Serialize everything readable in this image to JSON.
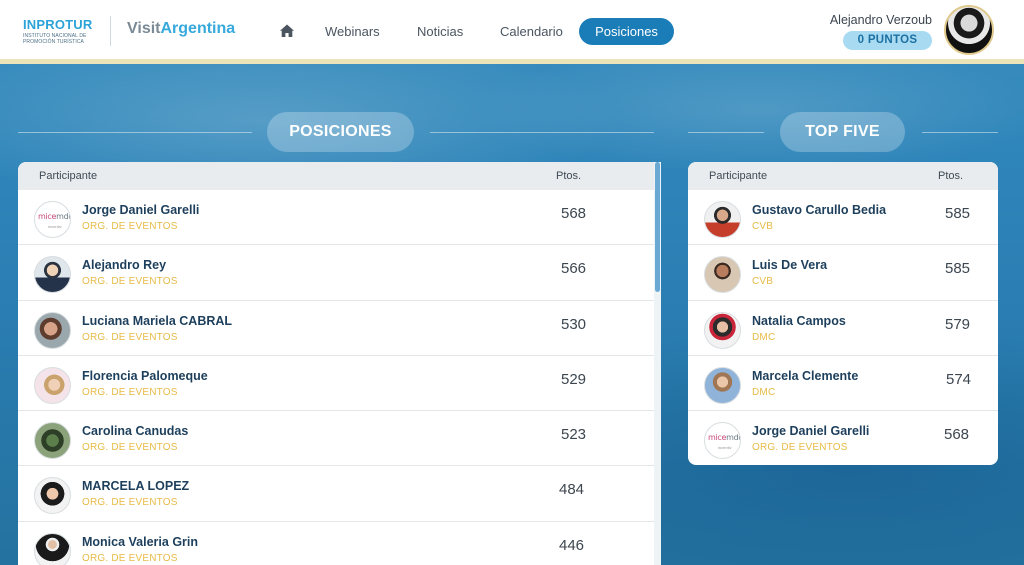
{
  "brand": {
    "inprotur_title": "INPROTUR",
    "inprotur_subtitle": "INSTITUTO NACIONAL DE PROMOCIÓN TURÍSTICA",
    "visit_prefix": "Visit",
    "visit_suffix": "Argentina"
  },
  "nav": {
    "home_icon": "home-icon",
    "items": [
      {
        "label": "Webinars"
      },
      {
        "label": "Noticias"
      },
      {
        "label": "Calendario"
      },
      {
        "label": "Posiciones"
      }
    ],
    "active": "Posiciones"
  },
  "user": {
    "name": "Alejandro Verzoub",
    "points": "0 PUNTOS"
  },
  "positions": {
    "title": "POSICIONES",
    "header": {
      "participant": "Participante",
      "points": "Ptos."
    },
    "rows": [
      {
        "name": "Jorge Daniel Garelli",
        "category": "ORG. DE EVENTOS",
        "points": "568"
      },
      {
        "name": "Alejandro Rey",
        "category": "ORG. DE EVENTOS",
        "points": "566"
      },
      {
        "name": "Luciana Mariela CABRAL",
        "category": "ORG. DE EVENTOS",
        "points": "530"
      },
      {
        "name": "Florencia Palomeque",
        "category": "ORG. DE EVENTOS",
        "points": "529"
      },
      {
        "name": "Carolina Canudas",
        "category": "ORG. DE EVENTOS",
        "points": "523"
      },
      {
        "name": "MARCELA LOPEZ",
        "category": "ORG. DE EVENTOS",
        "points": "484"
      },
      {
        "name": "Monica Valeria Grin",
        "category": "ORG. DE EVENTOS",
        "points": "446"
      }
    ]
  },
  "top_five": {
    "title": "TOP FIVE",
    "header": {
      "participant": "Participante",
      "points": "Ptos."
    },
    "rows": [
      {
        "name": "Gustavo Carullo Bedia",
        "category": "CVB",
        "points": "585"
      },
      {
        "name": "Luis De Vera",
        "category": "CVB",
        "points": "585"
      },
      {
        "name": "Natalia Campos",
        "category": "DMC",
        "points": "579"
      },
      {
        "name": "Marcela Clemente",
        "category": "DMC",
        "points": "574"
      },
      {
        "name": "Jorge Daniel Garelli",
        "category": "ORG. DE EVENTOS",
        "points": "568"
      }
    ]
  },
  "avatar_logo": {
    "mice": "mice",
    "mdq": "mdq",
    "tag": "incentiv"
  },
  "colors": {
    "accent": "#1b7db8",
    "category": "#e8bb47",
    "name": "#1d3f5c",
    "header_border": "#ede3b9"
  }
}
